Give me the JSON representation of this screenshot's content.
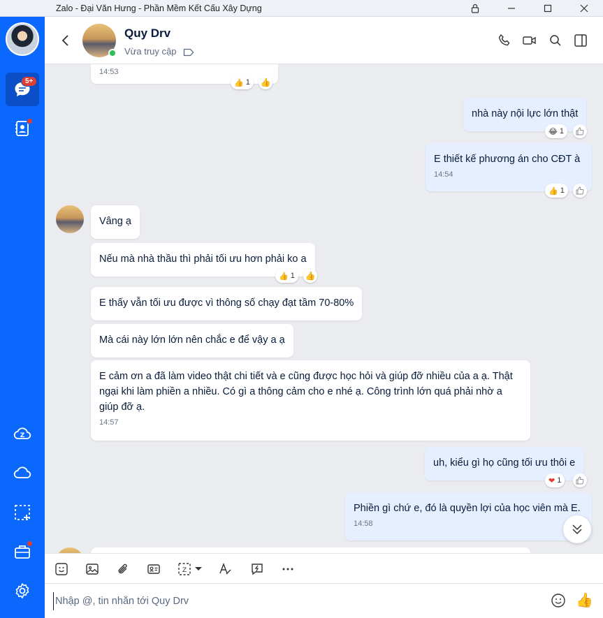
{
  "window": {
    "title": "Zalo - Đại Văn Hưng - Phần Mềm Kết Cấu Xây Dựng"
  },
  "sidebar": {
    "messages_badge": "5+"
  },
  "header": {
    "name": "Quy Drv",
    "status": "Vừa truy cập"
  },
  "messages": [
    {
      "id": "m0",
      "dir": "in",
      "text": "",
      "time": "14:53",
      "reaction_count": "1"
    },
    {
      "id": "m1",
      "dir": "out",
      "text": "nhà này nội lực lớn thật",
      "time": "",
      "reaction_count": "1"
    },
    {
      "id": "m2",
      "dir": "out",
      "text": "E thiết kế phương án cho CĐT à",
      "time": "14:54",
      "reaction_count": "1"
    },
    {
      "id": "m3",
      "dir": "in",
      "text": "Vâng ạ",
      "time": ""
    },
    {
      "id": "m4",
      "dir": "in",
      "text": "Nếu mà nhà thầu thì phải tối ưu hơn phải ko a",
      "time": "",
      "reaction_count": "1"
    },
    {
      "id": "m5",
      "dir": "in",
      "text": "E thấy vẫn tối ưu được vì thông số chạy đạt tầm 70-80%",
      "time": ""
    },
    {
      "id": "m6",
      "dir": "in",
      "text": "Mà cái này lớn lớn nên chắc e để vậy a ạ",
      "time": ""
    },
    {
      "id": "m7",
      "dir": "in",
      "text": "E cảm ơn a đã làm video thật chi tiết và e cũng được học hỏi và giúp đỡ nhiều của a ạ. Thật ngại khi làm phiền a nhiều. Có gì a thông cảm cho e nhé ạ. Công trình lớn quá phải nhờ a giúp đỡ ạ.",
      "time": "14:57"
    },
    {
      "id": "m8",
      "dir": "out",
      "text": "uh, kiểu gì họ cũng tối ưu thôi e",
      "time": "",
      "reaction_count": "1"
    },
    {
      "id": "m9",
      "dir": "out",
      "text": "Phiền gì chứ e, đó là quyền lợi của học viên mà E.",
      "time": "14:58"
    }
  ],
  "composer": {
    "placeholder": "Nhập @, tin nhắn tới Quy Drv"
  },
  "colors": {
    "sidebar": "#0a68ff",
    "outgoing_bubble": "#e5efff",
    "chat_bg": "#ebecf0",
    "online": "#2ebd59",
    "badge": "#e03e32"
  }
}
